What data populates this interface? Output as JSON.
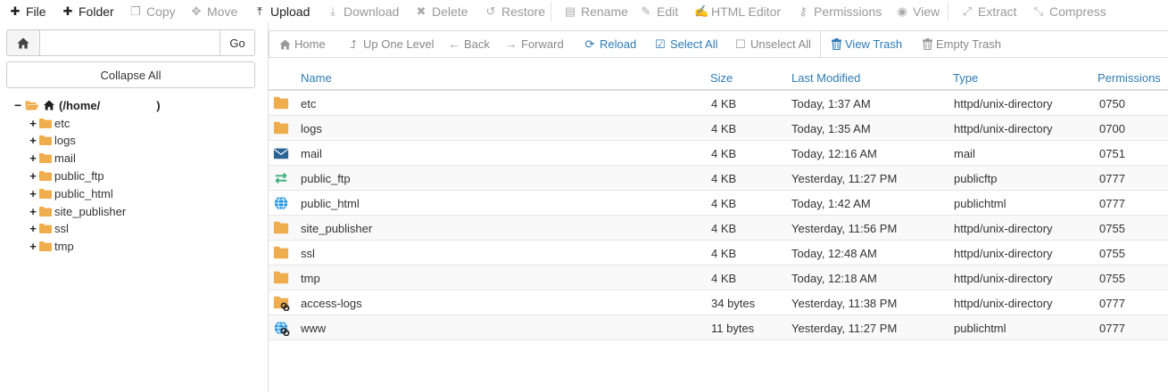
{
  "toolbar": {
    "items": [
      {
        "label": "File",
        "icon": "plus-icon",
        "enabled": true
      },
      {
        "label": "Folder",
        "icon": "plus-icon",
        "enabled": true
      },
      {
        "label": "Copy",
        "icon": "copy-icon",
        "enabled": false
      },
      {
        "label": "Move",
        "icon": "move-icon",
        "enabled": false
      },
      {
        "label": "Upload",
        "icon": "upload-icon",
        "enabled": true
      },
      {
        "label": "Download",
        "icon": "download-icon",
        "enabled": false
      },
      {
        "label": "Delete",
        "icon": "times-icon",
        "enabled": false
      },
      {
        "label": "Restore",
        "icon": "undo-icon",
        "enabled": false
      },
      {
        "label": "Rename",
        "icon": "file-icon",
        "enabled": false
      },
      {
        "label": "Edit",
        "icon": "pencil-icon",
        "enabled": false
      },
      {
        "label": "HTML Editor",
        "icon": "edit-icon",
        "enabled": false
      },
      {
        "label": "Permissions",
        "icon": "key-icon",
        "enabled": false
      },
      {
        "label": "View",
        "icon": "eye-icon",
        "enabled": false
      },
      {
        "label": "Extract",
        "icon": "expand-icon",
        "enabled": false
      },
      {
        "label": "Compress",
        "icon": "compress-icon",
        "enabled": false
      }
    ]
  },
  "sidebar": {
    "path_value": "",
    "go_label": "Go",
    "collapse_label": "Collapse All",
    "root_label": "(/home/",
    "root_label_end": ")",
    "tree_items": [
      "etc",
      "logs",
      "mail",
      "public_ftp",
      "public_html",
      "site_publisher",
      "ssl",
      "tmp"
    ]
  },
  "subtoolbar": {
    "items": [
      {
        "label": "Home",
        "icon": "home-icon",
        "enabled": false
      },
      {
        "label": "Up One Level",
        "icon": "level-up-icon",
        "enabled": false
      },
      {
        "label": "Back",
        "icon": "arrow-left-icon",
        "enabled": false
      },
      {
        "label": "Forward",
        "icon": "arrow-right-icon",
        "enabled": false
      },
      {
        "label": "Reload",
        "icon": "refresh-icon",
        "enabled": true
      },
      {
        "label": "Select All",
        "icon": "check-square-icon",
        "enabled": true
      },
      {
        "label": "Unselect All",
        "icon": "square-icon",
        "enabled": false
      },
      {
        "label": "View Trash",
        "icon": "trash-icon",
        "enabled": true
      },
      {
        "label": "Empty Trash",
        "icon": "trash-icon",
        "enabled": false
      }
    ]
  },
  "table": {
    "headers": {
      "name": "Name",
      "size": "Size",
      "modified": "Last Modified",
      "type": "Type",
      "perms": "Permissions"
    },
    "rows": [
      {
        "icon": "folder-icon",
        "name": "etc",
        "size": "4 KB",
        "modified": "Today, 1:37 AM",
        "type": "httpd/unix-directory",
        "perms": "0750"
      },
      {
        "icon": "folder-icon",
        "name": "logs",
        "size": "4 KB",
        "modified": "Today, 1:35 AM",
        "type": "httpd/unix-directory",
        "perms": "0700"
      },
      {
        "icon": "envelope-icon",
        "name": "mail",
        "size": "4 KB",
        "modified": "Today, 12:16 AM",
        "type": "mail",
        "perms": "0751"
      },
      {
        "icon": "exchange-icon",
        "name": "public_ftp",
        "size": "4 KB",
        "modified": "Yesterday, 11:27 PM",
        "type": "publicftp",
        "perms": "0777"
      },
      {
        "icon": "globe-icon",
        "name": "public_html",
        "size": "4 KB",
        "modified": "Today, 1:42 AM",
        "type": "publichtml",
        "perms": "0777"
      },
      {
        "icon": "folder-icon",
        "name": "site_publisher",
        "size": "4 KB",
        "modified": "Yesterday, 11:56 PM",
        "type": "httpd/unix-directory",
        "perms": "0755"
      },
      {
        "icon": "folder-icon",
        "name": "ssl",
        "size": "4 KB",
        "modified": "Today, 12:48 AM",
        "type": "httpd/unix-directory",
        "perms": "0755"
      },
      {
        "icon": "folder-icon",
        "name": "tmp",
        "size": "4 KB",
        "modified": "Today, 12:18 AM",
        "type": "httpd/unix-directory",
        "perms": "0755"
      },
      {
        "icon": "folder-link-icon",
        "name": "access-logs",
        "size": "34 bytes",
        "modified": "Yesterday, 11:38 PM",
        "type": "httpd/unix-directory",
        "perms": "0777"
      },
      {
        "icon": "globe-link-icon",
        "name": "www",
        "size": "11 bytes",
        "modified": "Yesterday, 11:27 PM",
        "type": "publichtml",
        "perms": "0777"
      }
    ]
  },
  "colors": {
    "accent": "#2e7bb4",
    "folder": "#f0ad4e",
    "mail": "#2a6496",
    "ftp": "#3ab07a",
    "globe": "#1d8fe1"
  }
}
